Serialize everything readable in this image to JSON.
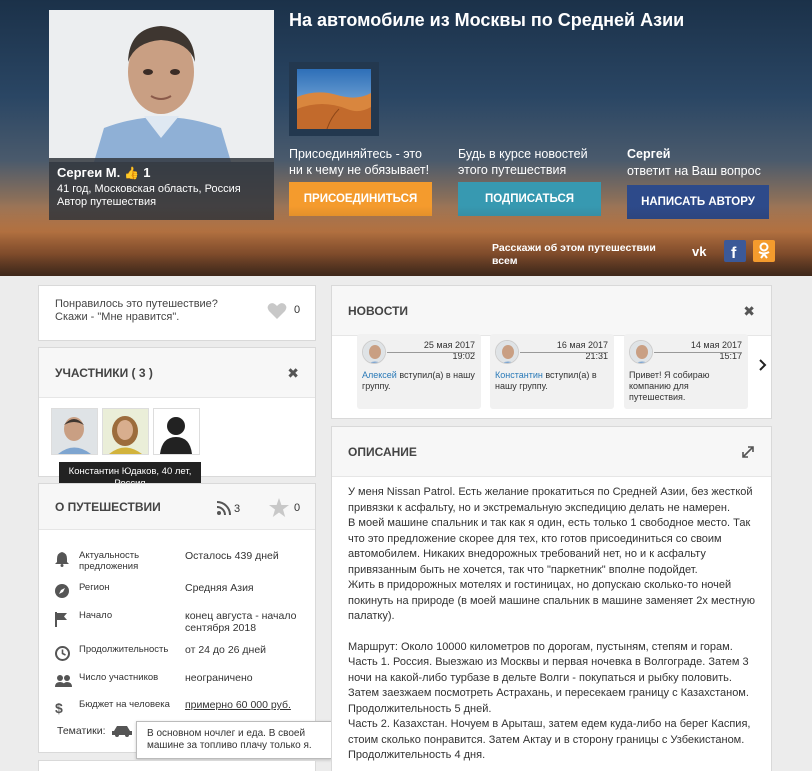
{
  "profile": {
    "name": "Сергеи М.",
    "rating": "1",
    "line1": "41 год, Московская область, Россия",
    "line2": "Автор путешествия"
  },
  "trip": {
    "title": "На автомобиле из Москвы по Средней Азии"
  },
  "cta": {
    "join_text": "Присоединяйтесь - это ни к чему не обязывает!",
    "join_button": "ПРИСОЕДИНИТЬСЯ",
    "subscribe_text": "Будь в курсе новостей этого путешествия",
    "subscribe_button": "ПОДПИСАТЬСЯ",
    "author_name": "Сергей",
    "author_text": "ответит на Ваш вопрос",
    "write_button": "НАПИСАТЬ АВТОРУ"
  },
  "share": {
    "text": "Расскажи об этом путешествии всем"
  },
  "colors": {
    "join": "#f49b2d",
    "subscribe": "#3799b1",
    "write": "#2d4a8a",
    "link": "#2a7ab8"
  },
  "like": {
    "text1": "Понравилось это путешествие?",
    "text2": "Скажи - \"Мне нравится\".",
    "count": "0"
  },
  "participants": {
    "title": "УЧАСТНИКИ ( 3 )",
    "tooltip1": "Константин Юдаков, 40 лет,",
    "tooltip2": "Россия"
  },
  "about": {
    "title": "О ПУТЕШЕСТВИИ",
    "rss_count": "3",
    "star_count": "0",
    "rows": [
      {
        "label": "Актуальность предложения",
        "value": "Осталось 439 дней",
        "icon": "bell-icon"
      },
      {
        "label": "Регион",
        "value": "Средняя Азия",
        "icon": "compass-icon"
      },
      {
        "label": "Начало",
        "value": "конец августа - начало сентября 2018",
        "icon": "flag-icon"
      },
      {
        "label": "Продолжительность",
        "value": "от 24 до 26 дней",
        "icon": "clock-icon"
      },
      {
        "label": "Число участников",
        "value": "неограничено",
        "icon": "people-icon"
      },
      {
        "label": "Бюджет на человека",
        "value": "примерно 60 000 руб.",
        "icon": "dollar-icon"
      }
    ],
    "topics_label": "Тематики:",
    "budget_tooltip": "В основном ночлег и еда. В своей машине за топливо плачу только я."
  },
  "news": {
    "title": "НОВОСТИ",
    "items": [
      {
        "date": "25 мая 2017",
        "time": "19:02",
        "name": "Алексей",
        "text": " вступил(а) в нашу группу."
      },
      {
        "date": "16 мая 2017",
        "time": "21:31",
        "name": "Константин",
        "text": " вступил(а) в нашу группу."
      },
      {
        "date": "14 мая 2017",
        "time": "15:17",
        "name": "",
        "text": "Привет! Я собираю компанию для путешествия."
      }
    ]
  },
  "description": {
    "title": "ОПИСАНИЕ",
    "p1": "У меня Nissan Patrol. Есть желание прокатиться по Средней Азии, без жесткой привязки к асфальту, но и экстремальную экспедицию делать не намерен.\nВ моей машине спальник и так как я один, есть только 1 свободное место. Так что это предложение скорее для тех, кто готов присоединиться со своим автомобилем. Никаких внедорожных требований нет, но и к асфальту привязанным быть не хочется, так что \"паркетник\" вполне подойдет.\nЖить в придорожных мотелях и гостиницах, но допускаю сколько-то ночей покинуть на природе (в моей машине спальник в машине заменяет 2х местную палатку).",
    "p2": "Маршрут: Около 10000 километров по дорогам, пустыням, степям и горам.\nЧасть 1. Россия. Выезжаю из Москвы и первая ночевка в Волгограде. Затем 3 ночи на какой-либо турбазе в дельте Волги - покупаться и рыбку половить. Затем заезжаем посмотреть Астрахань, и пересекаем границу с Казахстаном. Продолжительность 5 дней.\nЧасть 2. Казахстан. Ночуем в Арыташ, затем едем куда-либо на берег Каспия, стоим сколько понравится. Затем Актау и в сторону границы с Узбекистаном. Продолжительность 4 дня."
  }
}
